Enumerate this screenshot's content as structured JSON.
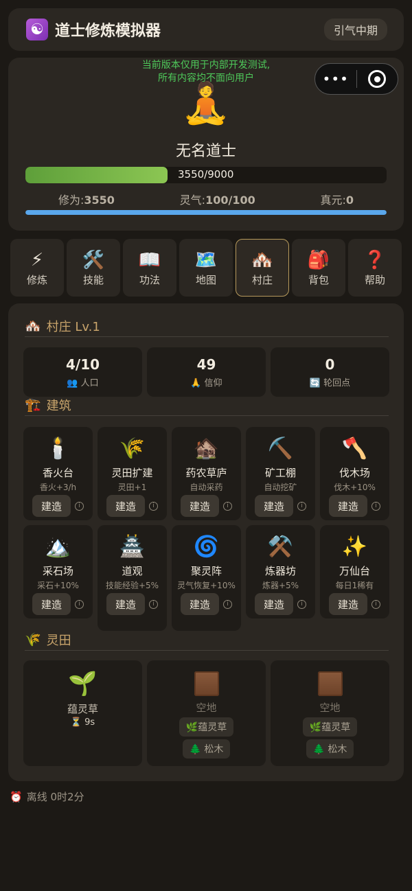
{
  "app": {
    "title": "道士修炼模拟器",
    "logo_icon": "yin-yang-icon",
    "stage": "引气中期"
  },
  "profile": {
    "notice_line1": "当前版本仅用于内部开发测试,",
    "notice_line2": "所有内容均不面向用户",
    "avatar_icon": "meditating-person-icon",
    "name": "无名道士",
    "xp_text": "3550/9000",
    "xp_fraction": 0.394,
    "stats": [
      {
        "label": "修为:",
        "value": "3550"
      },
      {
        "label": "灵气:",
        "value": "100/100"
      },
      {
        "label": "真元:",
        "value": "0"
      }
    ],
    "mp_fraction": 1.0
  },
  "capsule": {
    "more": "•••",
    "more_icon": "more-icon",
    "close_icon": "close-target-icon"
  },
  "tabs": [
    {
      "icon": "⚡",
      "label": "修炼",
      "active": false
    },
    {
      "icon": "🛠️",
      "label": "技能",
      "active": false
    },
    {
      "icon": "📖",
      "label": "功法",
      "active": false
    },
    {
      "icon": "🗺️",
      "label": "地图",
      "active": false
    },
    {
      "icon": "🏘️",
      "label": "村庄",
      "active": true
    },
    {
      "icon": "🎒",
      "label": "背包",
      "active": false
    },
    {
      "icon": "❓",
      "label": "帮助",
      "active": false
    }
  ],
  "village": {
    "title_icon": "🏘️",
    "title": "村庄 Lv.1",
    "counters": [
      {
        "value": "4/10",
        "icon": "👥",
        "label": "人口"
      },
      {
        "value": "49",
        "icon": "🙏",
        "label": "信仰"
      },
      {
        "value": "0",
        "icon": "🔄",
        "label": "轮回点"
      }
    ],
    "buildings_icon": "🏗️",
    "buildings_title": "建筑",
    "build_label": "建造",
    "info_glyph": "i",
    "buildings": [
      {
        "icon": "🕯️",
        "name": "香火台",
        "effect": "香火+3/h"
      },
      {
        "icon": "🌾",
        "name": "灵田扩建",
        "effect": "灵田+1"
      },
      {
        "icon": "🏚️",
        "name": "药农草庐",
        "effect": "自动采药"
      },
      {
        "icon": "⛏️",
        "name": "矿工棚",
        "effect": "自动挖矿"
      },
      {
        "icon": "🪓",
        "name": "伐木场",
        "effect": "伐木+10%"
      },
      {
        "icon": "🏔️",
        "name": "采石场",
        "effect": "采石+10%"
      },
      {
        "icon": "🏯",
        "name": "道观",
        "effect": "技能经验+5%"
      },
      {
        "icon": "🌀",
        "name": "聚灵阵",
        "effect": "灵气恢复+10%"
      },
      {
        "icon": "⚒️",
        "name": "炼器坊",
        "effect": "炼器+5%"
      },
      {
        "icon": "✨",
        "name": "万仙台",
        "effect": "每日1稀有"
      }
    ],
    "fields_icon": "🌾",
    "fields_title": "灵田",
    "fields": [
      {
        "state": "growing",
        "icon": "🌱",
        "name": "蕴灵草",
        "timer": "⏳ 9s"
      },
      {
        "state": "empty",
        "name": "空地",
        "seed1": "🌿蕴灵草",
        "seed2": "🌲 松木"
      },
      {
        "state": "empty",
        "name": "空地",
        "seed1": "🌿蕴灵草",
        "seed2": "🌲 松木"
      }
    ]
  },
  "offline": {
    "icon": "⏰",
    "text": "离线 0时2分"
  }
}
